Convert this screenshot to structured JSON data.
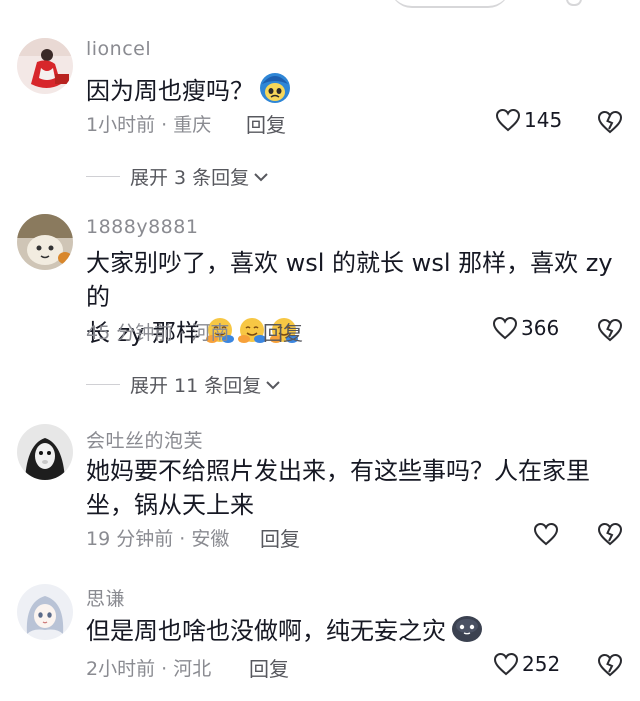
{
  "comments": [
    {
      "username": "lioncel",
      "content": "因为周也瘦吗？",
      "time": "1小时前",
      "location": "重庆",
      "reply_label": "回复",
      "likes": "145",
      "expand_label": "展开 3 条回复"
    },
    {
      "username": "1888y8881",
      "content_line1": "大家别吵了，喜欢 wsl 的就长 wsl 那样，喜欢 zy 的",
      "content_line2": "长 zy 那样",
      "time": "45 分钟前",
      "location": "河南",
      "reply_label": "回复",
      "likes": "366",
      "expand_label": "展开 11 条回复"
    },
    {
      "username": "会吐丝的泡芙",
      "content_line1": "她妈要不给照片发出来，有这些事吗？人在家里",
      "content_line2": "坐，锅从天上来",
      "time": "19 分钟前",
      "location": "安徽",
      "reply_label": "回复",
      "likes": ""
    },
    {
      "username": "思谦",
      "content": "但是周也啥也没做啊，纯无妄之灾",
      "time": "2小时前",
      "location": "河北",
      "reply_label": "回复",
      "likes": "252"
    }
  ],
  "separator": " · ",
  "colors": {
    "text_primary": "#161823",
    "text_secondary": "#8a8b91",
    "reply": "#57585e",
    "divider": "#d0d0d4"
  },
  "icons": {
    "like": "heart-outline-icon",
    "dislike": "broken-heart-outline-icon",
    "expand": "chevron-down-icon",
    "emoji_1": "blue-crying-face-emoji",
    "emoji_2": "hugging-face-emoji",
    "emoji_4": "dark-blob-face-emoji"
  }
}
